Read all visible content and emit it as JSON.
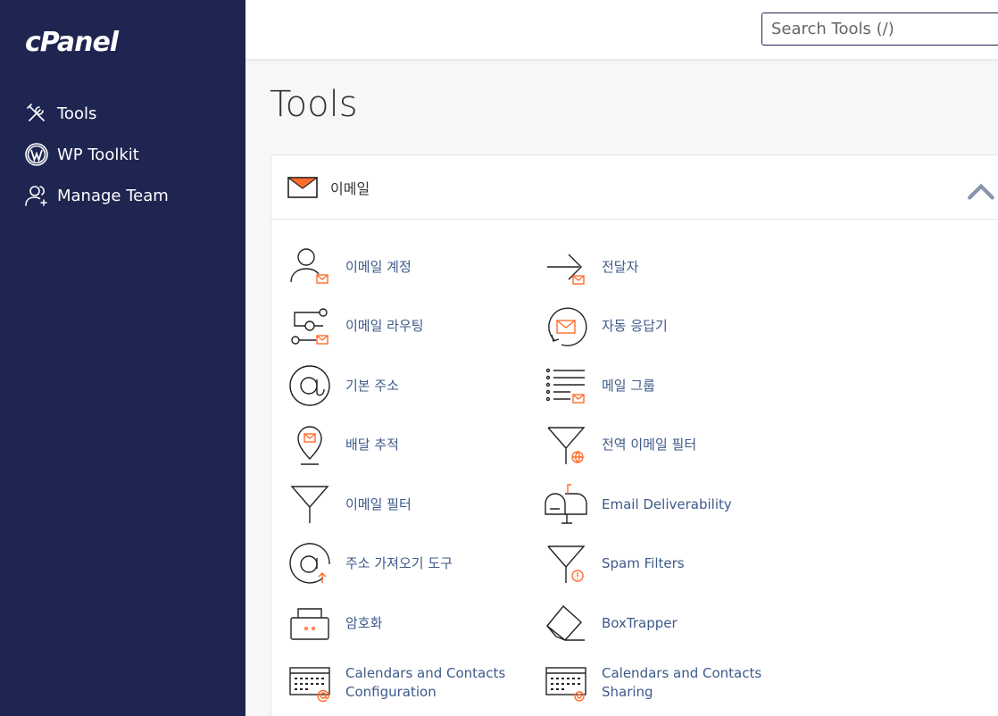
{
  "brand": {
    "logo_text": "cPanel"
  },
  "sidebar": {
    "items": [
      {
        "label": "Tools",
        "icon": "tools-icon"
      },
      {
        "label": "WP Toolkit",
        "icon": "wordpress-icon"
      },
      {
        "label": "Manage Team",
        "icon": "manage-team-icon"
      }
    ]
  },
  "header": {
    "search_placeholder": "Search Tools (/)"
  },
  "page": {
    "title": "Tools"
  },
  "panel": {
    "title": "이메일",
    "icon": "envelope-icon",
    "expanded": true,
    "tools": [
      {
        "label": "이메일 계정",
        "icon": "email-accounts-icon"
      },
      {
        "label": "전달자",
        "icon": "forwarders-icon"
      },
      {
        "label": "이메일 라우팅",
        "icon": "email-routing-icon"
      },
      {
        "label": "자동 응답기",
        "icon": "autoresponders-icon"
      },
      {
        "label": "기본 주소",
        "icon": "default-address-icon"
      },
      {
        "label": "메일 그룹",
        "icon": "mailing-lists-icon"
      },
      {
        "label": "배달 추적",
        "icon": "track-delivery-icon"
      },
      {
        "label": "전역 이메일 필터",
        "icon": "global-email-filters-icon"
      },
      {
        "label": "이메일 필터",
        "icon": "email-filters-icon"
      },
      {
        "label": "Email Deliverability",
        "icon": "mailbox-icon"
      },
      {
        "label": "주소 가져오기 도구",
        "icon": "address-importer-icon"
      },
      {
        "label": "Spam Filters",
        "icon": "spam-filters-icon"
      },
      {
        "label": "암호화",
        "icon": "encryption-icon"
      },
      {
        "label": "BoxTrapper",
        "icon": "boxtrapper-icon"
      },
      {
        "label": "Calendars and Contacts Configuration",
        "label_lines": [
          "Calendars and Contacts",
          "Configuration"
        ],
        "icon": "calendar-at-icon"
      },
      {
        "label": "Calendars and Contacts Sharing",
        "label_lines": [
          "Calendars and Contacts",
          "Sharing"
        ],
        "icon": "calendar-gear-icon"
      }
    ]
  },
  "colors": {
    "sidebar_bg": "#1f2551",
    "link": "#3d5a8a",
    "accent": "#ff6c2c"
  }
}
